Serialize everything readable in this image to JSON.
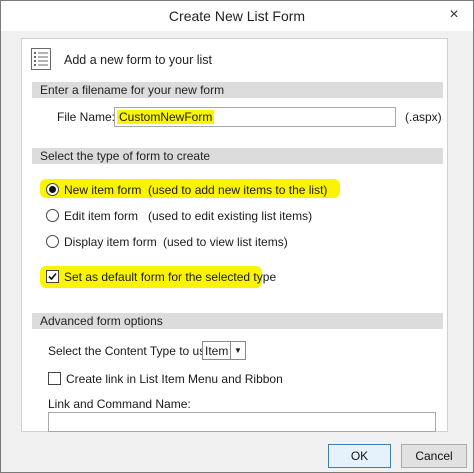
{
  "window": {
    "title": "Create New List Form",
    "close_glyph": "×"
  },
  "header": {
    "icon": "form-list-icon",
    "text": "Add a new form to your list"
  },
  "filename_section": {
    "heading": "Enter a filename for your new form",
    "label": "File Name:",
    "value": "CustomNewForm",
    "extension": "(.aspx)"
  },
  "type_section": {
    "heading": "Select the type of form to create",
    "options": [
      {
        "label": "New item form",
        "description": "(used to add new items to the list)",
        "selected": true
      },
      {
        "label": "Edit item form",
        "description": "(used to edit existing list items)",
        "selected": false
      },
      {
        "label": "Display item form",
        "description": "(used to view list items)",
        "selected": false
      }
    ],
    "default_checkbox": {
      "label": "Set as default form for the selected type",
      "checked": true
    }
  },
  "advanced_section": {
    "heading": "Advanced form options",
    "content_type_label": "Select the Content Type to use:",
    "content_type_value": "Item",
    "create_link_label": "Create link in List Item Menu and Ribbon",
    "create_link_checked": false,
    "link_name_label": "Link and Command Name:",
    "link_name_value": ""
  },
  "buttons": {
    "ok": "OK",
    "cancel": "Cancel"
  },
  "colors": {
    "highlight": "#fbf400",
    "section_bar": "#dcdcdc",
    "dialog_bg": "#f0f0f0"
  }
}
